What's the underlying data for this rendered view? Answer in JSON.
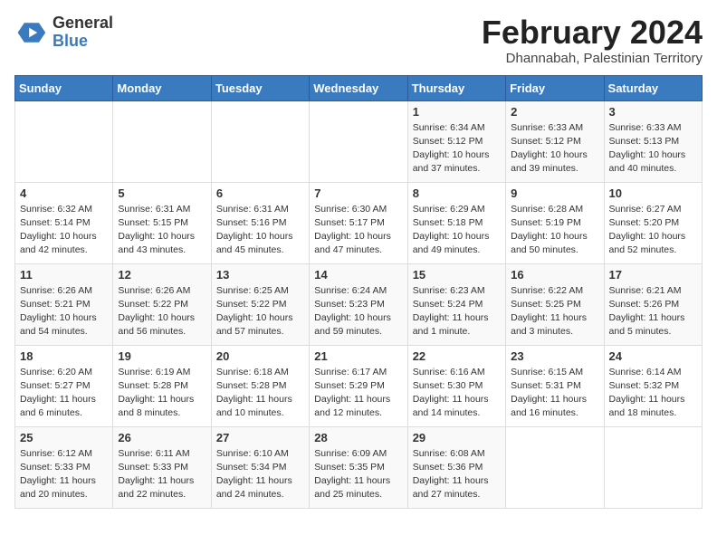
{
  "header": {
    "logo_line1": "General",
    "logo_line2": "Blue",
    "month_year": "February 2024",
    "location": "Dhannabah, Palestinian Territory"
  },
  "days_of_week": [
    "Sunday",
    "Monday",
    "Tuesday",
    "Wednesday",
    "Thursday",
    "Friday",
    "Saturday"
  ],
  "weeks": [
    [
      {
        "day": "",
        "info": ""
      },
      {
        "day": "",
        "info": ""
      },
      {
        "day": "",
        "info": ""
      },
      {
        "day": "",
        "info": ""
      },
      {
        "day": "1",
        "info": "Sunrise: 6:34 AM\nSunset: 5:12 PM\nDaylight: 10 hours\nand 37 minutes."
      },
      {
        "day": "2",
        "info": "Sunrise: 6:33 AM\nSunset: 5:12 PM\nDaylight: 10 hours\nand 39 minutes."
      },
      {
        "day": "3",
        "info": "Sunrise: 6:33 AM\nSunset: 5:13 PM\nDaylight: 10 hours\nand 40 minutes."
      }
    ],
    [
      {
        "day": "4",
        "info": "Sunrise: 6:32 AM\nSunset: 5:14 PM\nDaylight: 10 hours\nand 42 minutes."
      },
      {
        "day": "5",
        "info": "Sunrise: 6:31 AM\nSunset: 5:15 PM\nDaylight: 10 hours\nand 43 minutes."
      },
      {
        "day": "6",
        "info": "Sunrise: 6:31 AM\nSunset: 5:16 PM\nDaylight: 10 hours\nand 45 minutes."
      },
      {
        "day": "7",
        "info": "Sunrise: 6:30 AM\nSunset: 5:17 PM\nDaylight: 10 hours\nand 47 minutes."
      },
      {
        "day": "8",
        "info": "Sunrise: 6:29 AM\nSunset: 5:18 PM\nDaylight: 10 hours\nand 49 minutes."
      },
      {
        "day": "9",
        "info": "Sunrise: 6:28 AM\nSunset: 5:19 PM\nDaylight: 10 hours\nand 50 minutes."
      },
      {
        "day": "10",
        "info": "Sunrise: 6:27 AM\nSunset: 5:20 PM\nDaylight: 10 hours\nand 52 minutes."
      }
    ],
    [
      {
        "day": "11",
        "info": "Sunrise: 6:26 AM\nSunset: 5:21 PM\nDaylight: 10 hours\nand 54 minutes."
      },
      {
        "day": "12",
        "info": "Sunrise: 6:26 AM\nSunset: 5:22 PM\nDaylight: 10 hours\nand 56 minutes."
      },
      {
        "day": "13",
        "info": "Sunrise: 6:25 AM\nSunset: 5:22 PM\nDaylight: 10 hours\nand 57 minutes."
      },
      {
        "day": "14",
        "info": "Sunrise: 6:24 AM\nSunset: 5:23 PM\nDaylight: 10 hours\nand 59 minutes."
      },
      {
        "day": "15",
        "info": "Sunrise: 6:23 AM\nSunset: 5:24 PM\nDaylight: 11 hours\nand 1 minute."
      },
      {
        "day": "16",
        "info": "Sunrise: 6:22 AM\nSunset: 5:25 PM\nDaylight: 11 hours\nand 3 minutes."
      },
      {
        "day": "17",
        "info": "Sunrise: 6:21 AM\nSunset: 5:26 PM\nDaylight: 11 hours\nand 5 minutes."
      }
    ],
    [
      {
        "day": "18",
        "info": "Sunrise: 6:20 AM\nSunset: 5:27 PM\nDaylight: 11 hours\nand 6 minutes."
      },
      {
        "day": "19",
        "info": "Sunrise: 6:19 AM\nSunset: 5:28 PM\nDaylight: 11 hours\nand 8 minutes."
      },
      {
        "day": "20",
        "info": "Sunrise: 6:18 AM\nSunset: 5:28 PM\nDaylight: 11 hours\nand 10 minutes."
      },
      {
        "day": "21",
        "info": "Sunrise: 6:17 AM\nSunset: 5:29 PM\nDaylight: 11 hours\nand 12 minutes."
      },
      {
        "day": "22",
        "info": "Sunrise: 6:16 AM\nSunset: 5:30 PM\nDaylight: 11 hours\nand 14 minutes."
      },
      {
        "day": "23",
        "info": "Sunrise: 6:15 AM\nSunset: 5:31 PM\nDaylight: 11 hours\nand 16 minutes."
      },
      {
        "day": "24",
        "info": "Sunrise: 6:14 AM\nSunset: 5:32 PM\nDaylight: 11 hours\nand 18 minutes."
      }
    ],
    [
      {
        "day": "25",
        "info": "Sunrise: 6:12 AM\nSunset: 5:33 PM\nDaylight: 11 hours\nand 20 minutes."
      },
      {
        "day": "26",
        "info": "Sunrise: 6:11 AM\nSunset: 5:33 PM\nDaylight: 11 hours\nand 22 minutes."
      },
      {
        "day": "27",
        "info": "Sunrise: 6:10 AM\nSunset: 5:34 PM\nDaylight: 11 hours\nand 24 minutes."
      },
      {
        "day": "28",
        "info": "Sunrise: 6:09 AM\nSunset: 5:35 PM\nDaylight: 11 hours\nand 25 minutes."
      },
      {
        "day": "29",
        "info": "Sunrise: 6:08 AM\nSunset: 5:36 PM\nDaylight: 11 hours\nand 27 minutes."
      },
      {
        "day": "",
        "info": ""
      },
      {
        "day": "",
        "info": ""
      }
    ]
  ]
}
